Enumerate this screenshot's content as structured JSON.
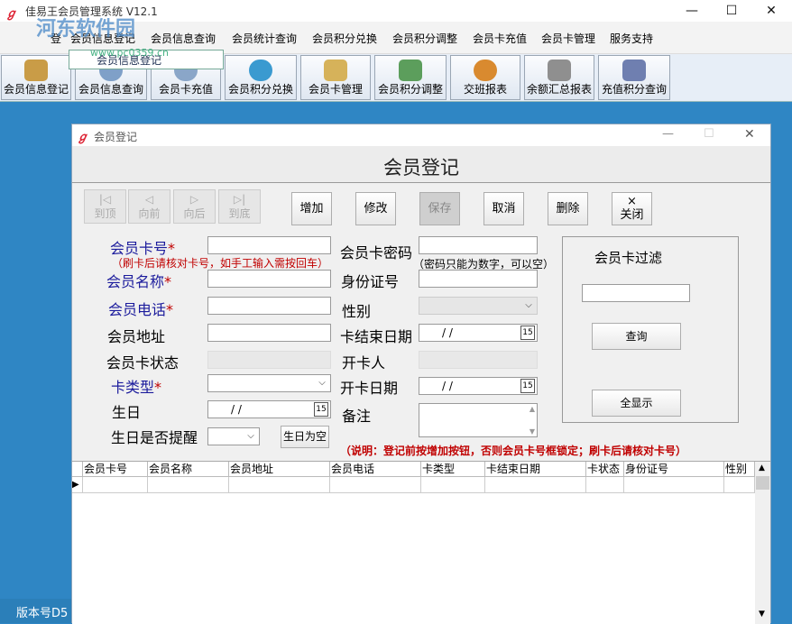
{
  "app": {
    "title": "佳易王会员管理系统 V12.1",
    "watermark": "河东软件园",
    "watermark_url": "www.pc0359.cn",
    "tooltip": "会员信息登记"
  },
  "window_controls": {
    "minimize": "—",
    "maximize": "☐",
    "close": "✕"
  },
  "menu": [
    "会员信息登记",
    "会员信息查询",
    "会员统计查询",
    "会员积分兑换",
    "会员积分调整",
    "会员卡充值",
    "会员卡管理",
    "服务支持"
  ],
  "menu_partial": "登",
  "toolbar": [
    {
      "label": "会员信息登记",
      "icon": "person-icon",
      "color": "#c99c47"
    },
    {
      "label": "会员信息查询",
      "icon": "magnifier-icon",
      "color": "#7fa0c8"
    },
    {
      "label": "会员卡充值",
      "icon": "search-icon",
      "color": "#8aa6c8"
    },
    {
      "label": "会员积分兑换",
      "icon": "eye-icon",
      "color": "#3a9ad0"
    },
    {
      "label": "会员卡管理",
      "icon": "clipboard-icon",
      "color": "#d6b25a"
    },
    {
      "label": "会员积分调整",
      "icon": "pen-icon",
      "color": "#5c9e5c"
    },
    {
      "label": "交班报表",
      "icon": "gear-icon",
      "color": "#d98a2f"
    },
    {
      "label": "余额汇总报表",
      "icon": "scroll-icon",
      "color": "#8f8f8f"
    },
    {
      "label": "充值积分查询",
      "icon": "calculator-icon",
      "color": "#6f7fb0"
    }
  ],
  "status": {
    "version": "版本号D5"
  },
  "dialog": {
    "title": "会员登记",
    "heading": "会员登记",
    "window_controls": {
      "minimize": "—",
      "maximize": "☐",
      "close": "✕"
    },
    "nav_buttons": [
      {
        "symbol": "|◁",
        "label": "到顶"
      },
      {
        "symbol": "◁",
        "label": "向前"
      },
      {
        "symbol": "▷",
        "label": "向后"
      },
      {
        "symbol": "▷|",
        "label": "到底"
      }
    ],
    "actions": {
      "add": "增加",
      "edit": "修改",
      "save": "保存",
      "cancel": "取消",
      "delete": "删除",
      "close": "关闭",
      "close_symbol": "×"
    },
    "labels": {
      "card_no": "会员卡号",
      "name": "会员名称",
      "phone": "会员电话",
      "address": "会员地址",
      "card_status": "会员卡状态",
      "card_type": "卡类型",
      "birthday": "生日",
      "birthday_remind": "生日是否提醒",
      "card_password": "会员卡密码",
      "id_no": "身份证号",
      "gender": "性别",
      "card_end_date": "卡结束日期",
      "opener": "开卡人",
      "open_date": "开卡日期",
      "remark": "备注",
      "required_mark": "*"
    },
    "hints": {
      "card_no": "（刷卡后请核对卡号，如手工输入需按回车）",
      "password": "（密码只能为数字，可以空）",
      "note": "（说明：登记前按增加按钮，否则会员卡号框锁定；刷卡后请核对卡号）"
    },
    "date_placeholder": "/  /",
    "calendar_symbol": "15",
    "clear_birthday_button": "生日为空",
    "filter": {
      "title": "会员卡过滤",
      "query_button": "查询",
      "show_all_button": "全显示"
    },
    "grid": {
      "columns": [
        "会员卡号",
        "会员名称",
        "会员地址",
        "会员电话",
        "卡类型",
        "卡结束日期",
        "卡状态",
        "身份证号",
        "性别"
      ],
      "row_marker": "▶"
    },
    "scroll": {
      "up": "▲",
      "down": "▼"
    }
  }
}
